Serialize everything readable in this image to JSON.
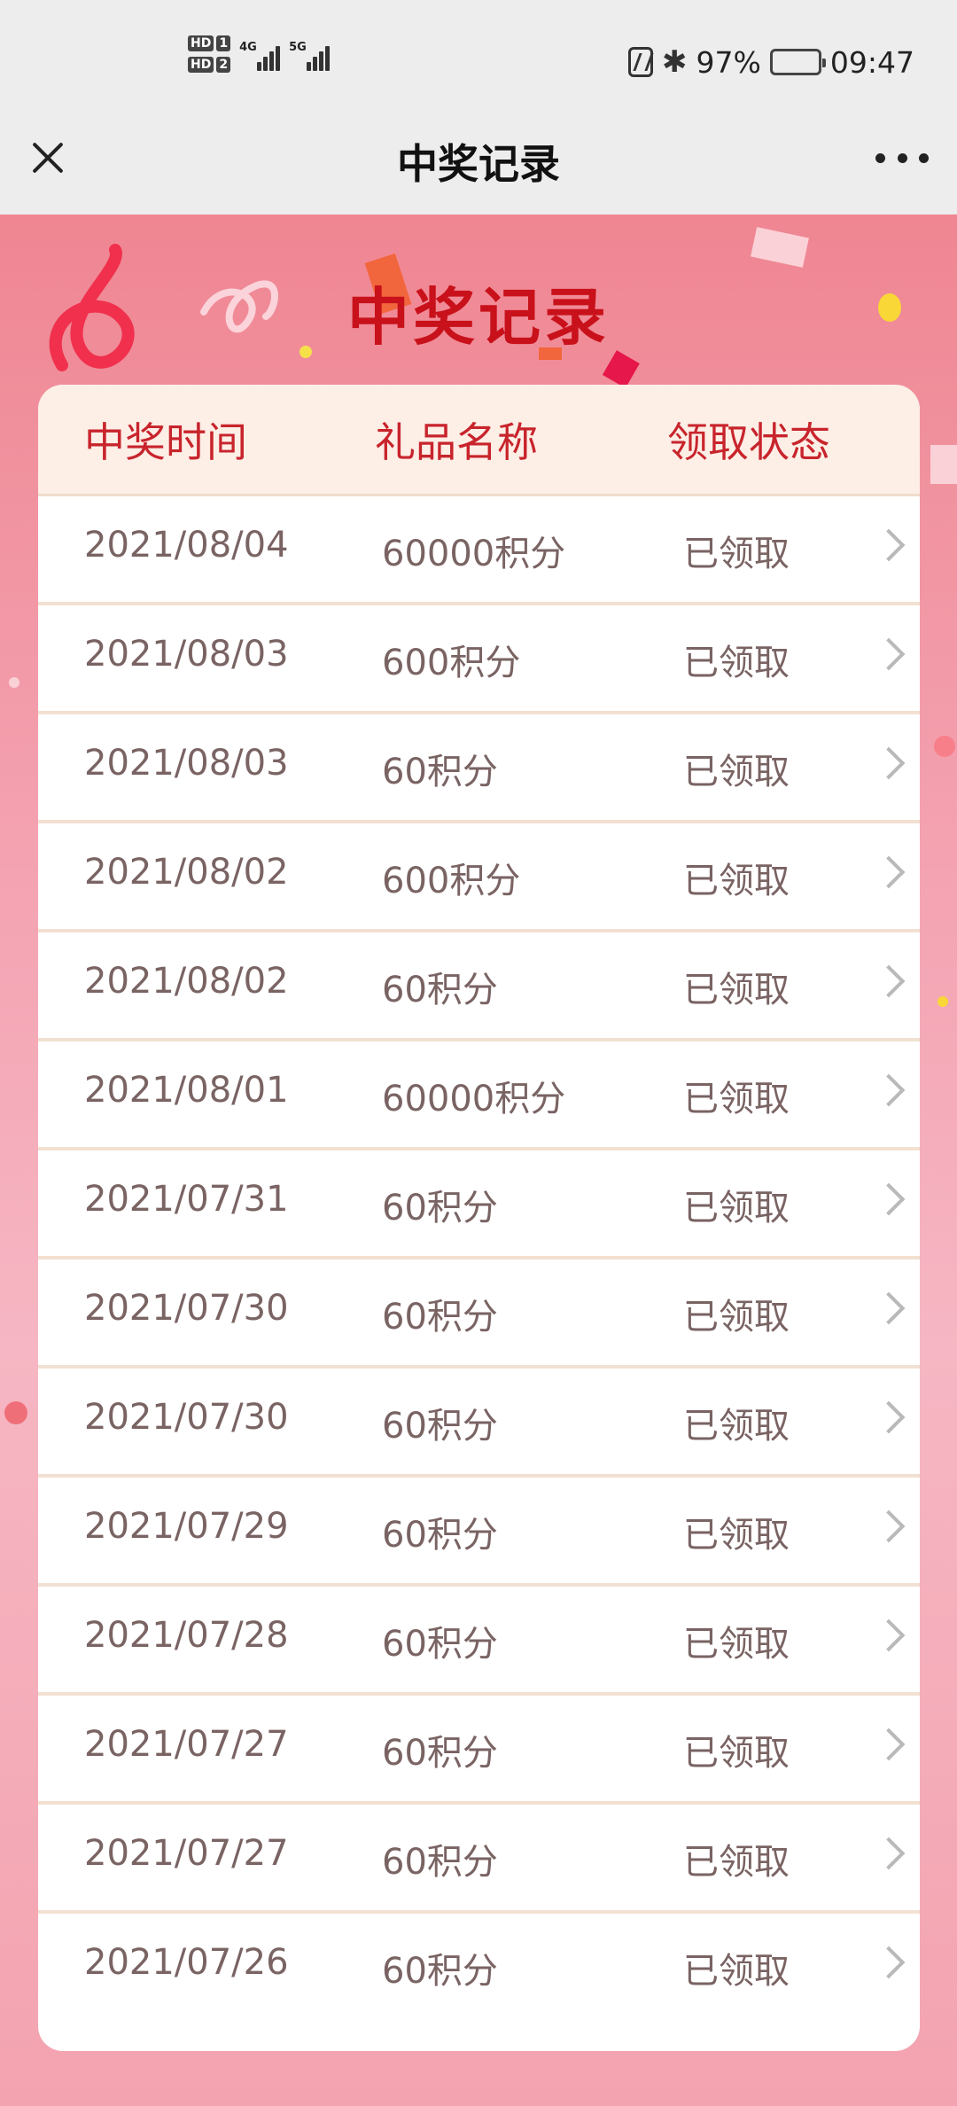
{
  "status_bar": {
    "hd1": "HD",
    "hd1_num": "1",
    "hd2": "HD",
    "hd2_num": "2",
    "net1": "4G",
    "net2": "5G",
    "battery_pct": "97%",
    "time": "09:47"
  },
  "nav": {
    "title": "中奖记录"
  },
  "page": {
    "heading": "中奖记录"
  },
  "table": {
    "headers": [
      "中奖时间",
      "礼品名称",
      "领取状态"
    ],
    "rows": [
      {
        "date": "2021/08/04",
        "gift": "60000积分",
        "status": "已领取"
      },
      {
        "date": "2021/08/03",
        "gift": "600积分",
        "status": "已领取"
      },
      {
        "date": "2021/08/03",
        "gift": "60积分",
        "status": "已领取"
      },
      {
        "date": "2021/08/02",
        "gift": "600积分",
        "status": "已领取"
      },
      {
        "date": "2021/08/02",
        "gift": "60积分",
        "status": "已领取"
      },
      {
        "date": "2021/08/01",
        "gift": "60000积分",
        "status": "已领取"
      },
      {
        "date": "2021/07/31",
        "gift": "60积分",
        "status": "已领取"
      },
      {
        "date": "2021/07/30",
        "gift": "60积分",
        "status": "已领取"
      },
      {
        "date": "2021/07/30",
        "gift": "60积分",
        "status": "已领取"
      },
      {
        "date": "2021/07/29",
        "gift": "60积分",
        "status": "已领取"
      },
      {
        "date": "2021/07/28",
        "gift": "60积分",
        "status": "已领取"
      },
      {
        "date": "2021/07/27",
        "gift": "60积分",
        "status": "已领取"
      },
      {
        "date": "2021/07/27",
        "gift": "60积分",
        "status": "已领取"
      },
      {
        "date": "2021/07/26",
        "gift": "60积分",
        "status": "已领取"
      }
    ]
  },
  "icons": {
    "close": "close-icon",
    "more": "more-icon",
    "chevron": "chevron-right-icon",
    "bluetooth": "bluetooth-icon",
    "nfc": "nfc-icon",
    "battery": "battery-icon"
  },
  "colors": {
    "heading_red": "#c8111a",
    "header_bg": "#fdeee6",
    "page_bg": "#ef8692"
  }
}
